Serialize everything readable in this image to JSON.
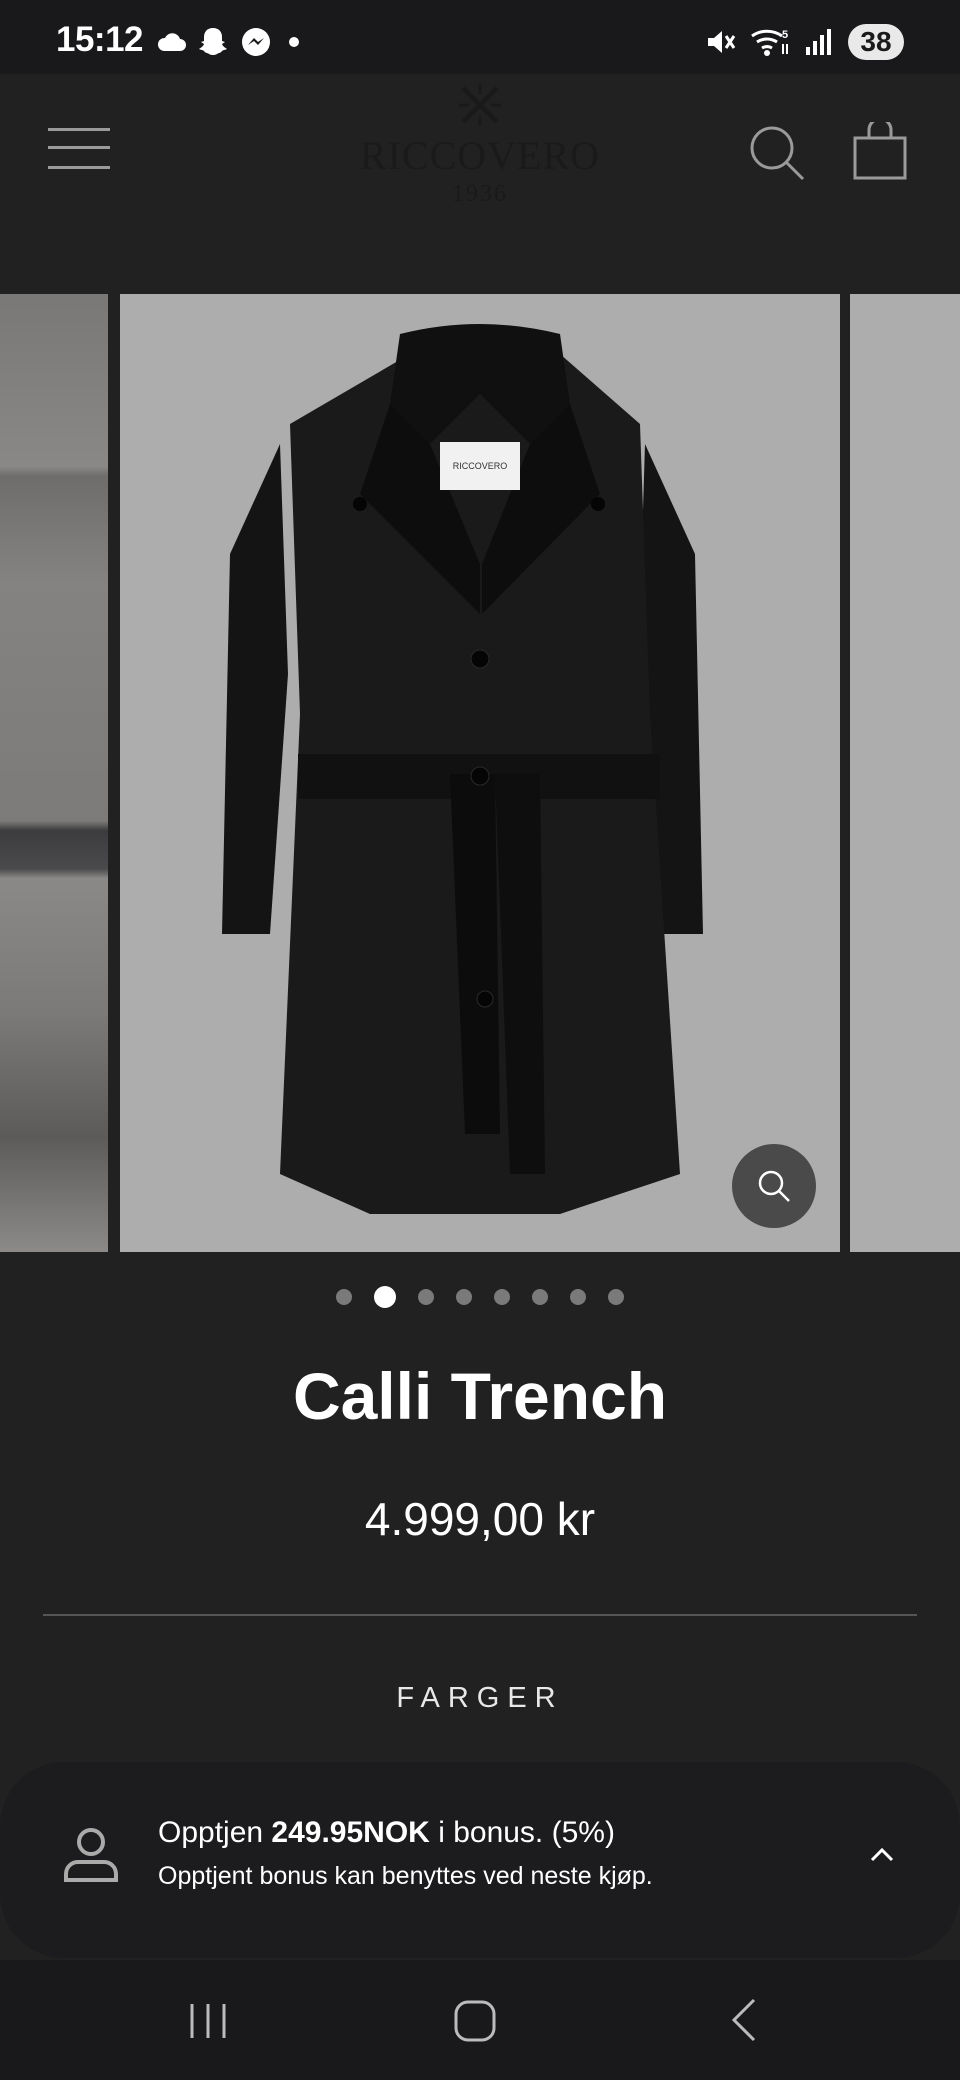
{
  "status_bar": {
    "time": "15:12",
    "battery": "38",
    "left_icons": [
      "cloud-icon",
      "snapchat-icon",
      "messenger-icon",
      "notification-dot-icon"
    ],
    "right_icons": [
      "mute-icon",
      "wifi-icon",
      "signal-icon",
      "battery-icon"
    ]
  },
  "header": {
    "brand_name": "RICCOVERO",
    "brand_year": "1936",
    "icons": [
      "menu-icon",
      "search-icon",
      "cart-icon"
    ]
  },
  "gallery": {
    "total_images": 8,
    "active_index": 1,
    "image_subject": "black trench coat"
  },
  "product": {
    "title": "Calli Trench",
    "price": "4.999,00 kr",
    "colors_label": "FARGER"
  },
  "bonus": {
    "prefix": "Opptjen ",
    "amount": "249.95NOK",
    "suffix": " i bonus. (5%)",
    "subtext": "Opptjent bonus kan benyttes ved neste kjøp."
  },
  "nav_bar": {
    "icons": [
      "recent-apps-icon",
      "home-icon",
      "back-icon"
    ]
  },
  "colors": {
    "background": "#212121",
    "status_bar": "#19191c",
    "image_background": "#adadad",
    "text": "#ffffff"
  }
}
